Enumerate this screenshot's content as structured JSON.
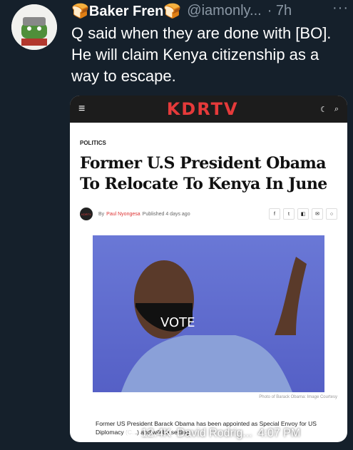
{
  "tweet": {
    "display_name": "🍞Baker Fren🍞",
    "handle": "@iamonly...",
    "time": "· 7h",
    "more_label": "···",
    "text": "Q said when they are done with [BO]. He will claim Kenya citizenship as a way to escape."
  },
  "article": {
    "site_name": "KDRTV",
    "menu_icon": "≡",
    "moon_icon": "☾",
    "search_icon": "⌕",
    "category": "POLITICS",
    "headline": "Former U.S President Obama To Relocate To Kenya In June",
    "byline_logo": "KDRTV",
    "by": "By",
    "author": "Paul Nyongesa",
    "published": "Published 4 days ago",
    "share": [
      "f",
      "t",
      "◧",
      "✉",
      "○"
    ],
    "photo_text": "VOTE",
    "caption": "Photo of Barack Obama: Image Courtesy",
    "body": "Former US President Barack Obama has been appointed as Special Envoy for US Diplomacy (C...) and will be setting"
  },
  "overlay": {
    "views": "12.4K",
    "author": "David Rodrig...",
    "time": "4:07 PM"
  }
}
